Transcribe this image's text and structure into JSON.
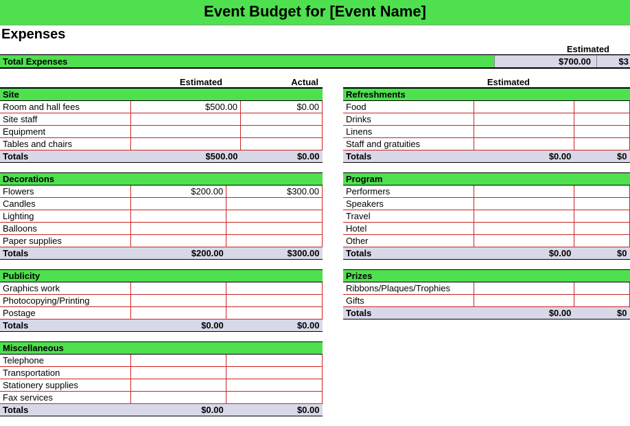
{
  "title": "Event Budget for [Event Name]",
  "section": "Expenses",
  "headers": {
    "estimated": "Estimated",
    "actual": "Actual"
  },
  "summary": {
    "label": "Total Expenses",
    "estimated": "$700.00",
    "actual_partial": "$3"
  },
  "left": [
    {
      "name": "Site",
      "rows": [
        {
          "label": "Room and hall fees",
          "est": "$500.00",
          "act": "$0.00"
        },
        {
          "label": "Site staff",
          "est": "",
          "act": ""
        },
        {
          "label": "Equipment",
          "est": "",
          "act": ""
        },
        {
          "label": "Tables and chairs",
          "est": "",
          "act": ""
        }
      ],
      "totals": {
        "label": "Totals",
        "est": "$500.00",
        "act": "$0.00"
      }
    },
    {
      "name": "Decorations",
      "rows": [
        {
          "label": "Flowers",
          "est": "$200.00",
          "act": "$300.00"
        },
        {
          "label": "Candles",
          "est": "",
          "act": ""
        },
        {
          "label": "Lighting",
          "est": "",
          "act": ""
        },
        {
          "label": "Balloons",
          "est": "",
          "act": ""
        },
        {
          "label": "Paper supplies",
          "est": "",
          "act": ""
        }
      ],
      "totals": {
        "label": "Totals",
        "est": "$200.00",
        "act": "$300.00"
      }
    },
    {
      "name": "Publicity",
      "rows": [
        {
          "label": "Graphics work",
          "est": "",
          "act": ""
        },
        {
          "label": "Photocopying/Printing",
          "est": "",
          "act": ""
        },
        {
          "label": "Postage",
          "est": "",
          "act": ""
        }
      ],
      "totals": {
        "label": "Totals",
        "est": "$0.00",
        "act": "$0.00"
      }
    },
    {
      "name": "Miscellaneous",
      "rows": [
        {
          "label": "Telephone",
          "est": "",
          "act": ""
        },
        {
          "label": "Transportation",
          "est": "",
          "act": ""
        },
        {
          "label": "Stationery supplies",
          "est": "",
          "act": ""
        },
        {
          "label": "Fax services",
          "est": "",
          "act": ""
        }
      ],
      "totals": {
        "label": "Totals",
        "est": "$0.00",
        "act": "$0.00"
      }
    }
  ],
  "right": [
    {
      "name": "Refreshments",
      "rows": [
        {
          "label": "Food",
          "est": "",
          "act": ""
        },
        {
          "label": "Drinks",
          "est": "",
          "act": ""
        },
        {
          "label": "Linens",
          "est": "",
          "act": ""
        },
        {
          "label": "Staff and gratuities",
          "est": "",
          "act": ""
        }
      ],
      "totals": {
        "label": "Totals",
        "est": "$0.00",
        "act": "$0"
      }
    },
    {
      "name": "Program",
      "rows": [
        {
          "label": "Performers",
          "est": "",
          "act": ""
        },
        {
          "label": "Speakers",
          "est": "",
          "act": ""
        },
        {
          "label": "Travel",
          "est": "",
          "act": ""
        },
        {
          "label": "Hotel",
          "est": "",
          "act": ""
        },
        {
          "label": "Other",
          "est": "",
          "act": ""
        }
      ],
      "totals": {
        "label": "Totals",
        "est": "$0.00",
        "act": "$0"
      }
    },
    {
      "name": "Prizes",
      "rows": [
        {
          "label": "Ribbons/Plaques/Trophies",
          "est": "",
          "act": ""
        },
        {
          "label": "Gifts",
          "est": "",
          "act": ""
        }
      ],
      "totals": {
        "label": "Totals",
        "est": "$0.00",
        "act": "$0"
      }
    }
  ]
}
